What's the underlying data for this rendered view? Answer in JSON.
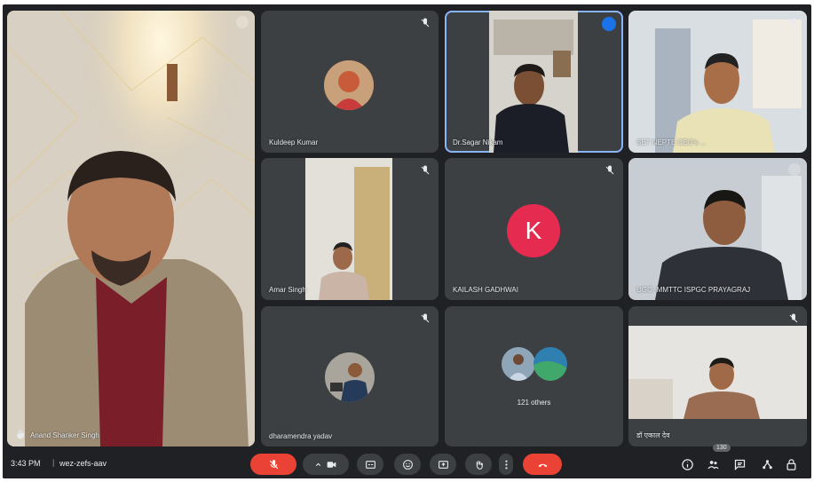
{
  "meeting": {
    "time": "3:43 PM",
    "separator": "|",
    "code": "wez-zefs-aav",
    "participant_count": "130"
  },
  "participants": {
    "p_main": "Anand Shanker Singh",
    "p1": "Kuldeep Kumar",
    "p2": "Dr.Sagar Nikam",
    "p3": "SET NEPTE CEO's ...",
    "p4": "Amar Singh",
    "p5": "KAILASH GADHWAI",
    "p5_initial": "K",
    "p6": "UGC- MMTTC ISPGC PRAYAGRAJ",
    "p7": "dharamendra yadav",
    "p8": "121 others",
    "p9": "डॉ एकाल देव"
  },
  "colors": {
    "accent": "#8ab4f8",
    "end_call": "#ea4335",
    "avatar_k": "#e52b50"
  },
  "icons": {
    "mic": "mic-off-icon",
    "camera": "camera-icon",
    "captions": "captions-icon",
    "emoji": "emoji-icon",
    "present": "present-icon",
    "hand": "raise-hand-icon",
    "more": "more-options-icon",
    "end": "end-call-icon"
  }
}
